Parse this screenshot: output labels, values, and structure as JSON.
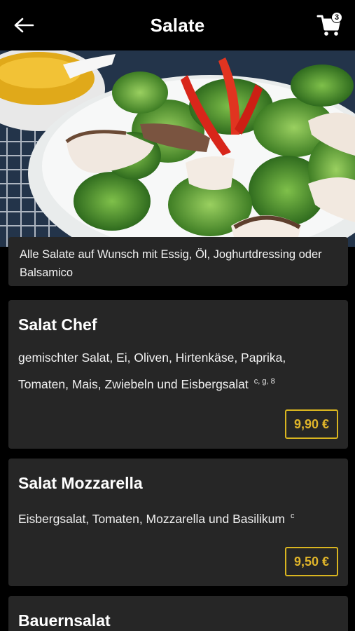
{
  "header": {
    "title": "Salate",
    "back_icon": "arrow-left-icon",
    "cart_icon": "shopping-cart-icon",
    "cart_count": "3"
  },
  "hero": {
    "image": "salad-bowl-photo"
  },
  "note": "Alle Salate auf Wunsch mit Essig, Öl, Joghurtdressing oder Balsamico",
  "accent_color": "#d9b520",
  "items": [
    {
      "name": "Salat Chef",
      "description": "gemischter Salat, Ei, Oliven, Hirtenkäse, Paprika, Tomaten, Mais, Zwiebeln und Eisbergsalat",
      "allergens": "c, g, 8",
      "price": "9,90 €"
    },
    {
      "name": "Salat Mozzarella",
      "description": "Eisbergsalat, Tomaten, Mozzarella und Basilikum",
      "allergens": "c",
      "price": "9,50 €"
    },
    {
      "name": "Bauernsalat"
    }
  ]
}
